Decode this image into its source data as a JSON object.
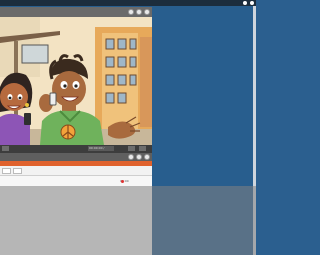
{
  "player": {
    "title": "",
    "time": "00:00:00 / 00:00:00",
    "controls": [
      "play",
      "fullscreen",
      "settings"
    ]
  },
  "win2": {
    "tabs": [],
    "rows": [
      {
        "left": "",
        "right": "00:00"
      },
      {
        "left": "",
        "right": ""
      }
    ]
  },
  "colors": {
    "desktop": "#285e8e",
    "accent_orange": "#e0622d"
  },
  "icons": [
    "close-icon",
    "maximize-icon",
    "minimize-icon",
    "play-icon",
    "fullscreen-icon"
  ]
}
